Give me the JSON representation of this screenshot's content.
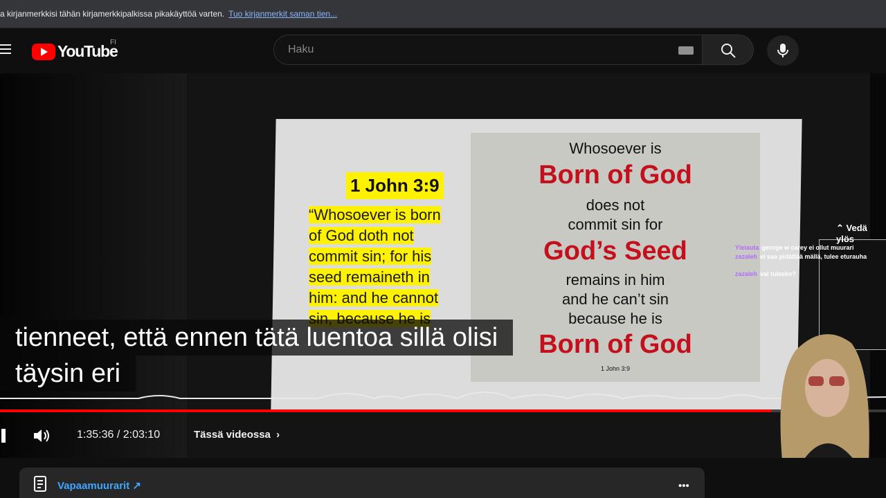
{
  "bookmarks_bar": {
    "message": "a kirjanmerkkisi tähän kirjamerkkipalkissa pikakäyttöä varten.",
    "import_link": "Tuo kirjanmerkit saman tien..."
  },
  "masthead": {
    "logo_text": "YouTube",
    "country_code": "FI",
    "search_placeholder": "Haku"
  },
  "video": {
    "slide": {
      "verse_ref": "1 John 3:9",
      "verse_lines": [
        "“Whosoever is born",
        "of God doth not",
        "commit sin; for his",
        "seed remaineth in",
        "him: and he cannot",
        "sin, because he is"
      ],
      "right_lines": [
        "Whosoever is",
        "Born of God",
        "does not",
        "commit sin for",
        "God’s Seed",
        "remains in him",
        "and he can’t sin",
        "because he is",
        "Born of God",
        "1 John 3:9"
      ]
    },
    "caption_line1": "tienneet, että ennen tätä luentoa sillä olisi",
    "caption_line2": "täysin eri",
    "progress": 0.87,
    "time_display": "1:35:36 / 2:03:10",
    "chapters_label": "Tässä videossa",
    "overlay": {
      "drag_label": "Vedä ylös",
      "chat": [
        {
          "user": "Yleiauta",
          "text": "george w carey ei ollut muurari"
        },
        {
          "user": "zazaleh",
          "text": "ei saa pidättää mällä, tulee eturauha"
        },
        {
          "user": "zazaleh",
          "text": "vai tuleeko?"
        }
      ]
    }
  },
  "description": {
    "chapter_link": "Vapaamuurarit ↗",
    "more": "•••"
  },
  "colors": {
    "accent_red": "#ff0000",
    "link_blue": "#3ea6ff",
    "chat_user": "#b46cff"
  }
}
